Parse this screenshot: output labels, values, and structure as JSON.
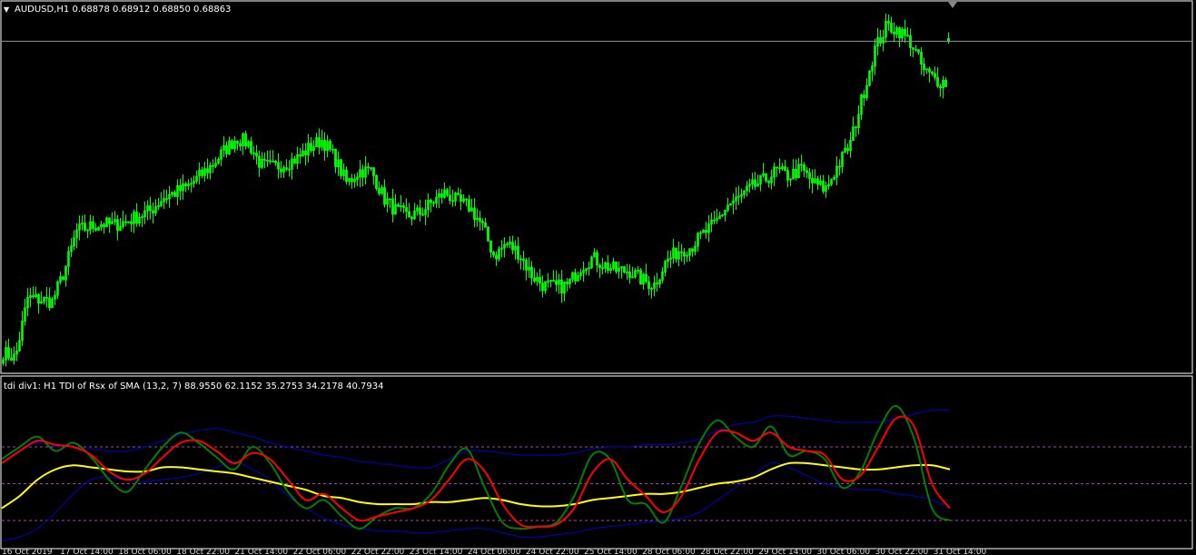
{
  "price_panel": {
    "arrow_glyph": "▼",
    "header": "AUDUSD,H1  0.68878 0.68912 0.68850 0.68863"
  },
  "indicator_panel": {
    "header": "tdi div1: H1  TDI of Rsx of SMA (13,2, 7) 88.9550 62.1152 35.2753 34.2178 40.7934"
  },
  "time_axis": {
    "labels": [
      "16 Oct 2019",
      "17 Oct 14:00",
      "18 Oct 06:00",
      "18 Oct 22:00",
      "21 Oct 14:00",
      "22 Oct 06:00",
      "22 Oct 22:00",
      "23 Oct 14:00",
      "24 Oct 06:00",
      "24 Oct 22:00",
      "25 Oct 14:00",
      "28 Oct 06:00",
      "28 Oct 22:00",
      "29 Oct 14:00",
      "30 Oct 06:00",
      "30 Oct 22:00",
      "31 Oct 14:00"
    ]
  },
  "colors": {
    "background": "#000000",
    "grid_border": "#ffffff",
    "candles": "#00ff00",
    "bid_line": "#8899aa",
    "rsi_line": "#008000",
    "signal_line": "#ff0000",
    "market_base": "#ffff00",
    "volatility_band": "#0000cc",
    "levels": "#aa44aa"
  },
  "chart_data": [
    {
      "type": "candlestick",
      "symbol": "AUDUSD",
      "timeframe": "H1",
      "ohlc_last": {
        "open": 0.68878,
        "high": 0.68912,
        "low": 0.6885,
        "close": 0.68863
      },
      "close_path": [
        0.6715,
        0.6712,
        0.6745,
        0.6744,
        0.6743,
        0.676,
        0.6782,
        0.6784,
        0.6786,
        0.6785,
        0.6787,
        0.679,
        0.6793,
        0.68,
        0.6803,
        0.6806,
        0.6812,
        0.6818,
        0.6826,
        0.6833,
        0.683,
        0.6818,
        0.6817,
        0.6819,
        0.6822,
        0.6828,
        0.6832,
        0.6822,
        0.6808,
        0.6815,
        0.6815,
        0.68,
        0.6793,
        0.679,
        0.6792,
        0.6798,
        0.6803,
        0.6798,
        0.6795,
        0.6785,
        0.6768,
        0.6775,
        0.677,
        0.6758,
        0.6752,
        0.6751,
        0.6752,
        0.6762,
        0.6767,
        0.6763,
        0.676,
        0.676,
        0.6755,
        0.6752,
        0.6765,
        0.6771,
        0.6773,
        0.678,
        0.6786,
        0.6796,
        0.68,
        0.6806,
        0.681,
        0.6815,
        0.6812,
        0.6816,
        0.6808,
        0.6805,
        0.6818,
        0.683,
        0.6856,
        0.6882,
        0.6895,
        0.6892,
        0.6885,
        0.687,
        0.6865,
        0.6863
      ],
      "ylim": [
        0.6705,
        0.69
      ],
      "current_price": 0.68863
    },
    {
      "type": "line",
      "title": "TDI of Rsx of SMA (13,2, 7)",
      "levels": [
        68,
        50,
        32
      ],
      "ylim": [
        20,
        100
      ],
      "series": [
        {
          "key": "rsi",
          "color": "#008000",
          "values": [
            62,
            68,
            73,
            66,
            70,
            63,
            52,
            46,
            57,
            68,
            75,
            70,
            63,
            57,
            68,
            60,
            46,
            38,
            42,
            34,
            28,
            34,
            38,
            38,
            45,
            59,
            67,
            48,
            31,
            28,
            29,
            31,
            44,
            64,
            62,
            42,
            40,
            31,
            49,
            70,
            81,
            73,
            68,
            78,
            64,
            66,
            62,
            48,
            56,
            76,
            88,
            72,
            38,
            32
          ]
        },
        {
          "key": "signal",
          "color": "#ff0000",
          "values": [
            60,
            66,
            71,
            69,
            68,
            64,
            56,
            52,
            55,
            63,
            70,
            71,
            66,
            60,
            65,
            62,
            52,
            42,
            45,
            38,
            32,
            34,
            36,
            38,
            42,
            52,
            62,
            56,
            40,
            30,
            29,
            30,
            38,
            55,
            62,
            52,
            44,
            36,
            44,
            62,
            75,
            75,
            71,
            75,
            68,
            66,
            64,
            52,
            54,
            68,
            82,
            78,
            50,
            38
          ]
        },
        {
          "key": "market_base",
          "color": "#ffff00",
          "values": [
            38,
            44,
            52,
            57,
            59,
            58,
            57,
            56,
            56,
            58,
            58,
            57,
            56,
            55,
            53,
            51,
            49,
            47,
            44,
            43,
            41,
            40,
            40,
            40,
            41,
            41,
            42,
            43,
            42,
            40,
            39,
            39,
            40,
            42,
            43,
            44,
            45,
            45,
            46,
            48,
            50,
            51,
            53,
            57,
            60,
            60,
            59,
            58,
            57,
            57,
            58,
            59,
            59,
            57
          ]
        },
        {
          "key": "upper_band",
          "color": "#0000cc",
          "values": [
            60,
            66,
            70,
            68,
            68,
            67,
            66,
            66,
            68,
            71,
            74,
            76,
            77,
            75,
            73,
            70,
            68,
            66,
            64,
            63,
            61,
            60,
            59,
            58,
            58,
            62,
            66,
            66,
            65,
            64,
            64,
            64,
            65,
            67,
            68,
            68,
            69,
            69,
            70,
            72,
            76,
            79,
            80,
            83,
            83,
            82,
            81,
            80,
            80,
            80,
            82,
            84,
            86,
            86
          ]
        },
        {
          "key": "lower_band",
          "color": "#0000cc",
          "values": [
            22,
            24,
            28,
            36,
            45,
            52,
            53,
            52,
            51,
            52,
            53,
            55,
            58,
            61,
            57,
            52,
            44,
            38,
            33,
            30,
            28,
            27,
            27,
            26,
            26,
            27,
            28,
            28,
            26,
            24,
            24,
            25,
            26,
            28,
            29,
            30,
            31,
            32,
            33,
            36,
            42,
            48,
            54,
            60,
            58,
            54,
            50,
            48,
            47,
            47,
            45,
            44,
            42,
            38
          ]
        }
      ]
    }
  ]
}
